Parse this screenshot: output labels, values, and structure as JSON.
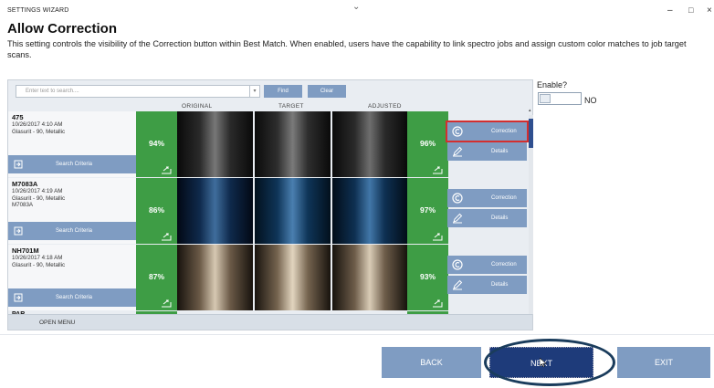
{
  "window": {
    "title": "SETTINGS WIZARD",
    "minimize": "–",
    "maximize": "□",
    "close": "×"
  },
  "header": {
    "title": "Allow Correction",
    "description": "This setting controls the visibility of the Correction button within Best Match.  When enabled, users have the capability to link spectro jobs and assign custom color matches to job target scans."
  },
  "search": {
    "placeholder": "Enter text to search....",
    "find_label": "Find",
    "clear_label": "Clear"
  },
  "columns": {
    "original": "ORIGINAL",
    "target": "TARGET",
    "adjusted": "ADJUSTED"
  },
  "rows": [
    {
      "code": "475",
      "meta": "10/26/2017 4:10 AM\nGlasurit - 90, Metallic",
      "pct_original": "94%",
      "pct_adjusted": "96%",
      "criteria_label": "Search Criteria",
      "correction_label": "Correction",
      "details_label": "Details"
    },
    {
      "code": "M7083A",
      "meta": "10/26/2017 4:19 AM\nGlasurit - 90, Metallic\nM7083A",
      "pct_original": "86%",
      "pct_adjusted": "97%",
      "criteria_label": "Search Criteria",
      "correction_label": "Correction",
      "details_label": "Details"
    },
    {
      "code": "NH701M",
      "meta": "10/26/2017 4:18 AM\nGlasurit - 90, Metallic",
      "pct_original": "87%",
      "pct_adjusted": "93%",
      "criteria_label": "Search Criteria",
      "correction_label": "Correction",
      "details_label": "Details"
    }
  ],
  "partial_row_code": "PAR",
  "open_menu_label": "OPEN MENU",
  "enable": {
    "label": "Enable?",
    "value": "NO"
  },
  "nav": {
    "back": "BACK",
    "next": "NEXT",
    "exit": "EXIT"
  },
  "colors": {
    "accent": "#7f9cc2",
    "match_green": "#3e9d45",
    "next_button": "#1e3b7a",
    "selected_outline": "#d32f2f"
  }
}
